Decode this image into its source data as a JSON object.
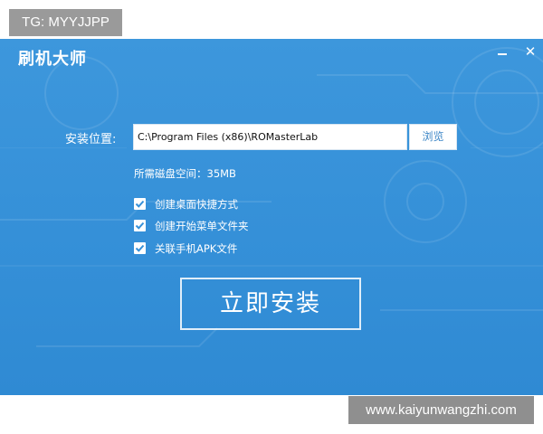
{
  "watermarks": {
    "top_left": "TG: MYYJJPP",
    "bottom_right": "www.kaiyunwangzhi.com"
  },
  "window": {
    "title": "刷机大师",
    "minimize_icon": "minimize-icon",
    "close_icon": "close-icon",
    "close_glyph": "✕",
    "background_color": "#3590d8"
  },
  "install_path": {
    "label": "安装位置:",
    "value": "C:\\Program Files (x86)\\ROMasterLab",
    "browse_label": "浏览"
  },
  "disk_space": "所需磁盘空间：35MB",
  "options": [
    {
      "label": "创建桌面快捷方式",
      "checked": true
    },
    {
      "label": "创建开始菜单文件夹",
      "checked": true
    },
    {
      "label": "关联手机APK文件",
      "checked": true
    }
  ],
  "install_button": "立即安装"
}
